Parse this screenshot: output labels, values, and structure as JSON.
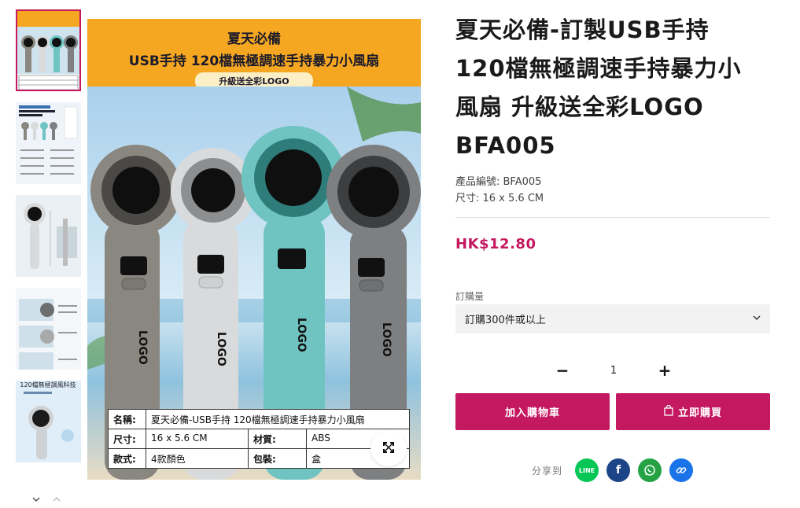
{
  "product": {
    "title": "夏天必備-訂製USB手持120檔無極調速手持暴力小風扇 升級送全彩LOGO BFA005",
    "title_lines": [
      "夏天必備-訂製USB手持",
      "120檔無極調速手持暴力小",
      "風扇 升級送全彩LOGO",
      "BFA005"
    ],
    "code_label": "產品編號: BFA005",
    "size_label": "尺寸: 16 x 5.6 CM",
    "price": "HK$12.80"
  },
  "order": {
    "quantity_label": "訂購量",
    "selected_option": "訂購300件或以上",
    "quantity_value": "1",
    "decrement_symbol": "−",
    "increment_symbol": "+",
    "add_to_cart_label": "加入購物車",
    "buy_now_label": "立即購買"
  },
  "share": {
    "label": "分享到",
    "icons": [
      "line-icon",
      "facebook-icon",
      "whatsapp-icon",
      "link-icon"
    ],
    "line_text": "LINE",
    "facebook_text": "f"
  },
  "main_image": {
    "banner_line1": "夏天必備",
    "banner_line2": "USB手持 120檔無極調速手持暴力小風扇",
    "banner_badge": "升級送全彩LOGO",
    "logo_text": "LOGO",
    "spec": {
      "name_label": "名稱:",
      "name_value": "夏天必備-USB手持 120檔無極調速手持暴力小風扇",
      "size_label": "尺寸:",
      "size_value": "16 x 5.6 CM",
      "material_label": "材質:",
      "material_value": "ABS",
      "style_label": "款式:",
      "style_value": "4款顏色",
      "package_label": "包裝:",
      "package_value": "盒"
    }
  },
  "thumbnails": {
    "thumb5_caption": "120檔無極調風科技"
  },
  "colors": {
    "accent": "#c41860",
    "banner": "#f6a722",
    "fan_colors": [
      "#8a8780",
      "#d9dadb",
      "#6fc4c1",
      "#7d7f80"
    ],
    "line": "#06c755",
    "facebook": "#1c4587",
    "whatsapp": "#25a244",
    "link": "#1a73e8"
  }
}
